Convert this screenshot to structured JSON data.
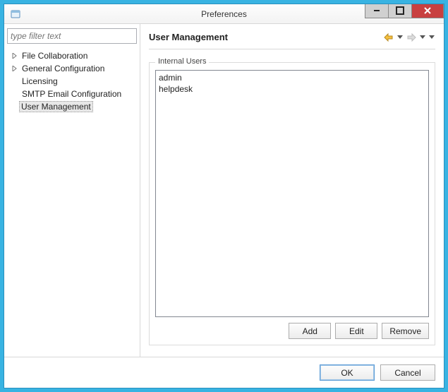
{
  "window": {
    "title": "Preferences"
  },
  "sidebar": {
    "filter_placeholder": "type filter text",
    "items": [
      {
        "label": "File Collaboration",
        "has_children": true
      },
      {
        "label": "General Configuration",
        "has_children": true
      },
      {
        "label": "Licensing",
        "has_children": false
      },
      {
        "label": "SMTP Email Configuration",
        "has_children": false
      },
      {
        "label": "User Management",
        "has_children": false,
        "selected": true
      }
    ]
  },
  "main": {
    "title": "User Management",
    "groupbox_label": "Internal Users",
    "users": [
      "admin",
      "helpdesk"
    ],
    "buttons": {
      "add": "Add",
      "edit": "Edit",
      "remove": "Remove"
    }
  },
  "footer": {
    "ok": "OK",
    "cancel": "Cancel"
  }
}
